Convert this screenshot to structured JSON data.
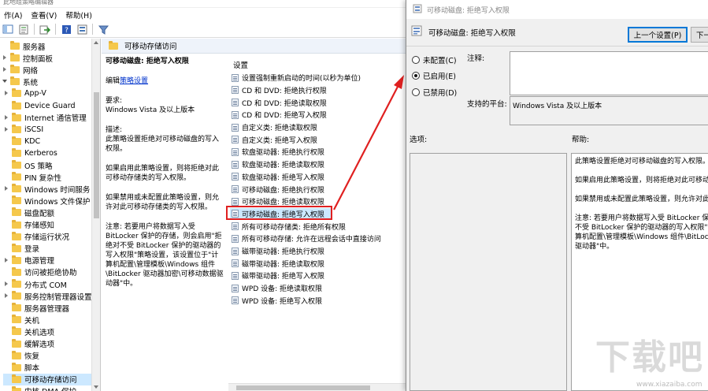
{
  "editor": {
    "title_fragment": "此地组策略编辑器",
    "menu": [
      "作(A)",
      "查看(V)",
      "帮助(H)"
    ],
    "tree": [
      {
        "label": "服务器",
        "exp": "none",
        "indent": 0
      },
      {
        "label": "控制面板",
        "exp": "c",
        "indent": 0
      },
      {
        "label": "网络",
        "exp": "c",
        "indent": 0
      },
      {
        "label": "系统",
        "exp": "o",
        "indent": 0
      },
      {
        "label": "App-V",
        "exp": "c",
        "indent": 1
      },
      {
        "label": "Device Guard",
        "exp": "none",
        "indent": 1
      },
      {
        "label": "Internet 通信管理",
        "exp": "c",
        "indent": 1
      },
      {
        "label": "iSCSI",
        "exp": "c",
        "indent": 1
      },
      {
        "label": "KDC",
        "exp": "none",
        "indent": 1
      },
      {
        "label": "Kerberos",
        "exp": "none",
        "indent": 1
      },
      {
        "label": "OS 策略",
        "exp": "none",
        "indent": 1
      },
      {
        "label": "PIN 复杂性",
        "exp": "none",
        "indent": 1
      },
      {
        "label": "Windows 时间服务",
        "exp": "c",
        "indent": 1
      },
      {
        "label": "Windows 文件保护",
        "exp": "none",
        "indent": 1
      },
      {
        "label": "磁盘配额",
        "exp": "none",
        "indent": 1
      },
      {
        "label": "存储感知",
        "exp": "none",
        "indent": 1
      },
      {
        "label": "存储运行状况",
        "exp": "none",
        "indent": 1
      },
      {
        "label": "登录",
        "exp": "none",
        "indent": 1
      },
      {
        "label": "电源管理",
        "exp": "c",
        "indent": 1
      },
      {
        "label": "访问被拒绝协助",
        "exp": "none",
        "indent": 1
      },
      {
        "label": "分布式 COM",
        "exp": "c",
        "indent": 1
      },
      {
        "label": "服务控制管理器设置",
        "exp": "c",
        "indent": 1
      },
      {
        "label": "服务器管理器",
        "exp": "none",
        "indent": 1
      },
      {
        "label": "关机",
        "exp": "none",
        "indent": 1
      },
      {
        "label": "关机选项",
        "exp": "none",
        "indent": 1
      },
      {
        "label": "缓解选项",
        "exp": "none",
        "indent": 1
      },
      {
        "label": "恢复",
        "exp": "none",
        "indent": 1
      },
      {
        "label": "脚本",
        "exp": "none",
        "indent": 1
      },
      {
        "label": "可移动存储访问",
        "exp": "none",
        "indent": 1,
        "selected": true
      },
      {
        "label": "内核 DMA 保护",
        "exp": "none",
        "indent": 1
      }
    ],
    "pane_header": "可移动存储访问",
    "description": {
      "title": "可移动磁盘: 拒绝写入权限",
      "edit_prefix": "编辑",
      "edit_link": "策略设置",
      "req_label": "要求:",
      "req_value": "Windows Vista 及以上版本",
      "desc_label": "描述:",
      "desc_1": "此策略设置拒绝对可移动磁盘的写入权限。",
      "desc_2": "如果启用此策略设置，则将拒绝对此可移动存储类的写入权限。",
      "desc_3": "如果禁用或未配置此策略设置，则允许对此可移动存储类的写入权限。",
      "note": "注意: 若要用户将数据写入受 BitLocker 保护的存储，则会启用\"拒绝对不受 BitLocker 保护的驱动器的写入权限\"策略设置，该设置位于\"计算机配置\\管理模板\\Windows 组件\\BitLocker 驱动器加密\\可移动数据驱动器\"中。"
    },
    "settings_header": "设置",
    "settings": [
      "设置强制重新启动的时间(以秒为单位)",
      "CD 和 DVD: 拒绝执行权限",
      "CD 和 DVD: 拒绝读取权限",
      "CD 和 DVD: 拒绝写入权限",
      "自定义类: 拒绝读取权限",
      "自定义类: 拒绝写入权限",
      "软盘驱动器: 拒绝执行权限",
      "软盘驱动器: 拒绝读取权限",
      "软盘驱动器: 拒绝写入权限",
      "可移动磁盘: 拒绝执行权限",
      "可移动磁盘: 拒绝读取权限",
      "可移动磁盘: 拒绝写入权限",
      "所有可移动存储类: 拒绝所有权限",
      "所有可移动存储: 允许在远程会话中直接访问",
      "磁带驱动器: 拒绝执行权限",
      "磁带驱动器: 拒绝读取权限",
      "磁带驱动器: 拒绝写入权限",
      "WPD 设备: 拒绝读取权限",
      "WPD 设备: 拒绝写入权限"
    ],
    "selected_setting_index": 11
  },
  "dialog": {
    "title": "可移动磁盘: 拒绝写入权限",
    "heading": "可移动磁盘: 拒绝写入权限",
    "prev_button": "上一个设置(P)",
    "next_button": "下一",
    "radio_not_configured": "未配置(C)",
    "radio_enabled": "已启用(E)",
    "radio_disabled": "已禁用(D)",
    "comment_label": "注释:",
    "platform_label": "支持的平台:",
    "platform_value": "Windows Vista 及以上版本",
    "options_label": "选项:",
    "help_label": "帮助:",
    "help_lines": [
      "此策略设置拒绝对可移动磁盘的写入权限。",
      "如果启用此策略设置，则将拒绝对此可移动存",
      "如果禁用或未配置此策略设置，则允许对此可",
      "注意: 若要用户将数据写入受 BitLocker 保护的",
      "不受 BitLocker 保护的驱动器的写入权限\"",
      "算机配置\\管理模板\\Windows 组件\\BitLock",
      "驱动器\"中。"
    ]
  },
  "watermark": {
    "big": "下载吧",
    "url": "www.xiazaiba.com"
  },
  "colors": {
    "selection": "#cce8ff",
    "highlight_red": "#e02020",
    "folder": "#f5c84c"
  }
}
